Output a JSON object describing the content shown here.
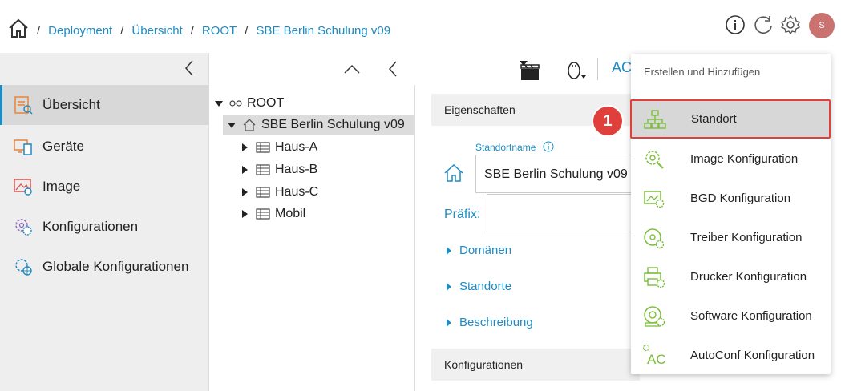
{
  "breadcrumb": {
    "items": [
      "Deployment",
      "Übersicht",
      "ROOT",
      "SBE Berlin Schulung v09"
    ],
    "separator": "/"
  },
  "header": {
    "avatar_initial": "S",
    "icons": [
      "home-icon",
      "info-icon",
      "refresh-icon",
      "settings-gear-icon"
    ]
  },
  "sidebar": {
    "items": [
      {
        "label": "Übersicht",
        "active": true
      },
      {
        "label": "Geräte"
      },
      {
        "label": "Image"
      },
      {
        "label": "Konfigurationen"
      },
      {
        "label": "Globale Konfigurationen"
      }
    ]
  },
  "tree": {
    "root": "ROOT",
    "selected": "SBE Berlin Schulung v09",
    "children": [
      "Haus-A",
      "Haus-B",
      "Haus-C",
      "Mobil"
    ]
  },
  "main": {
    "toolbar_text": "AC",
    "properties_title": "Eigenschaften",
    "field_label": "Standortname",
    "field_value": "SBE Berlin Schulung v09",
    "praefix_label": "Präfix:",
    "expanders": [
      "Domänen",
      "Standorte",
      "Beschreibung"
    ],
    "config_title": "Konfigurationen"
  },
  "menu": {
    "title": "Erstellen und Hinzufügen",
    "items": [
      "Standort",
      "Image Konfiguration",
      "BGD Konfiguration",
      "Treiber Konfiguration",
      "Drucker Konfiguration",
      "Software Konfiguration",
      "AutoConf Konfiguration"
    ],
    "highlighted_index": 0,
    "autoconf_icon_text": "AC"
  },
  "annotation": {
    "badge_number": "1"
  },
  "colors": {
    "link": "#1e8bc3",
    "icon_green": "#7cbf3c",
    "highlight_border": "#e0403c",
    "avatar": "#c9726f"
  }
}
